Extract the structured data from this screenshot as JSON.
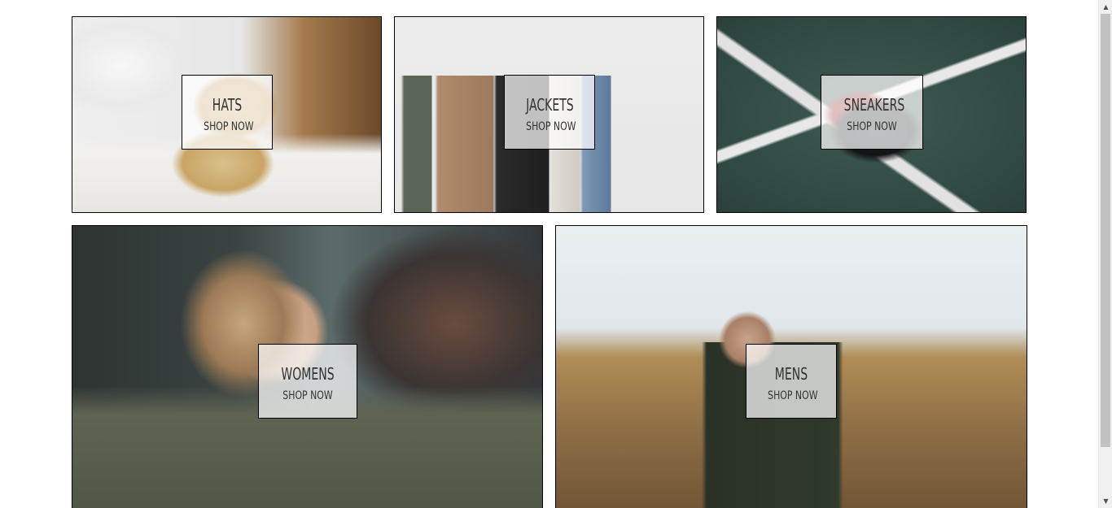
{
  "categories": [
    {
      "id": "hats",
      "title": "HATS",
      "cta": "SHOP NOW"
    },
    {
      "id": "jackets",
      "title": "JACKETS",
      "cta": "SHOP NOW"
    },
    {
      "id": "sneakers",
      "title": "SNEAKERS",
      "cta": "SHOP NOW"
    },
    {
      "id": "womens",
      "title": "WOMENS",
      "cta": "SHOP NOW"
    },
    {
      "id": "mens",
      "title": "MENS",
      "cta": "SHOP NOW"
    }
  ],
  "scrollbar": {
    "up_arrow": "▲",
    "down_arrow": "▼"
  },
  "icons": {
    "scroll_up": "scroll-up-arrow-icon",
    "scroll_down": "scroll-down-arrow-icon"
  }
}
